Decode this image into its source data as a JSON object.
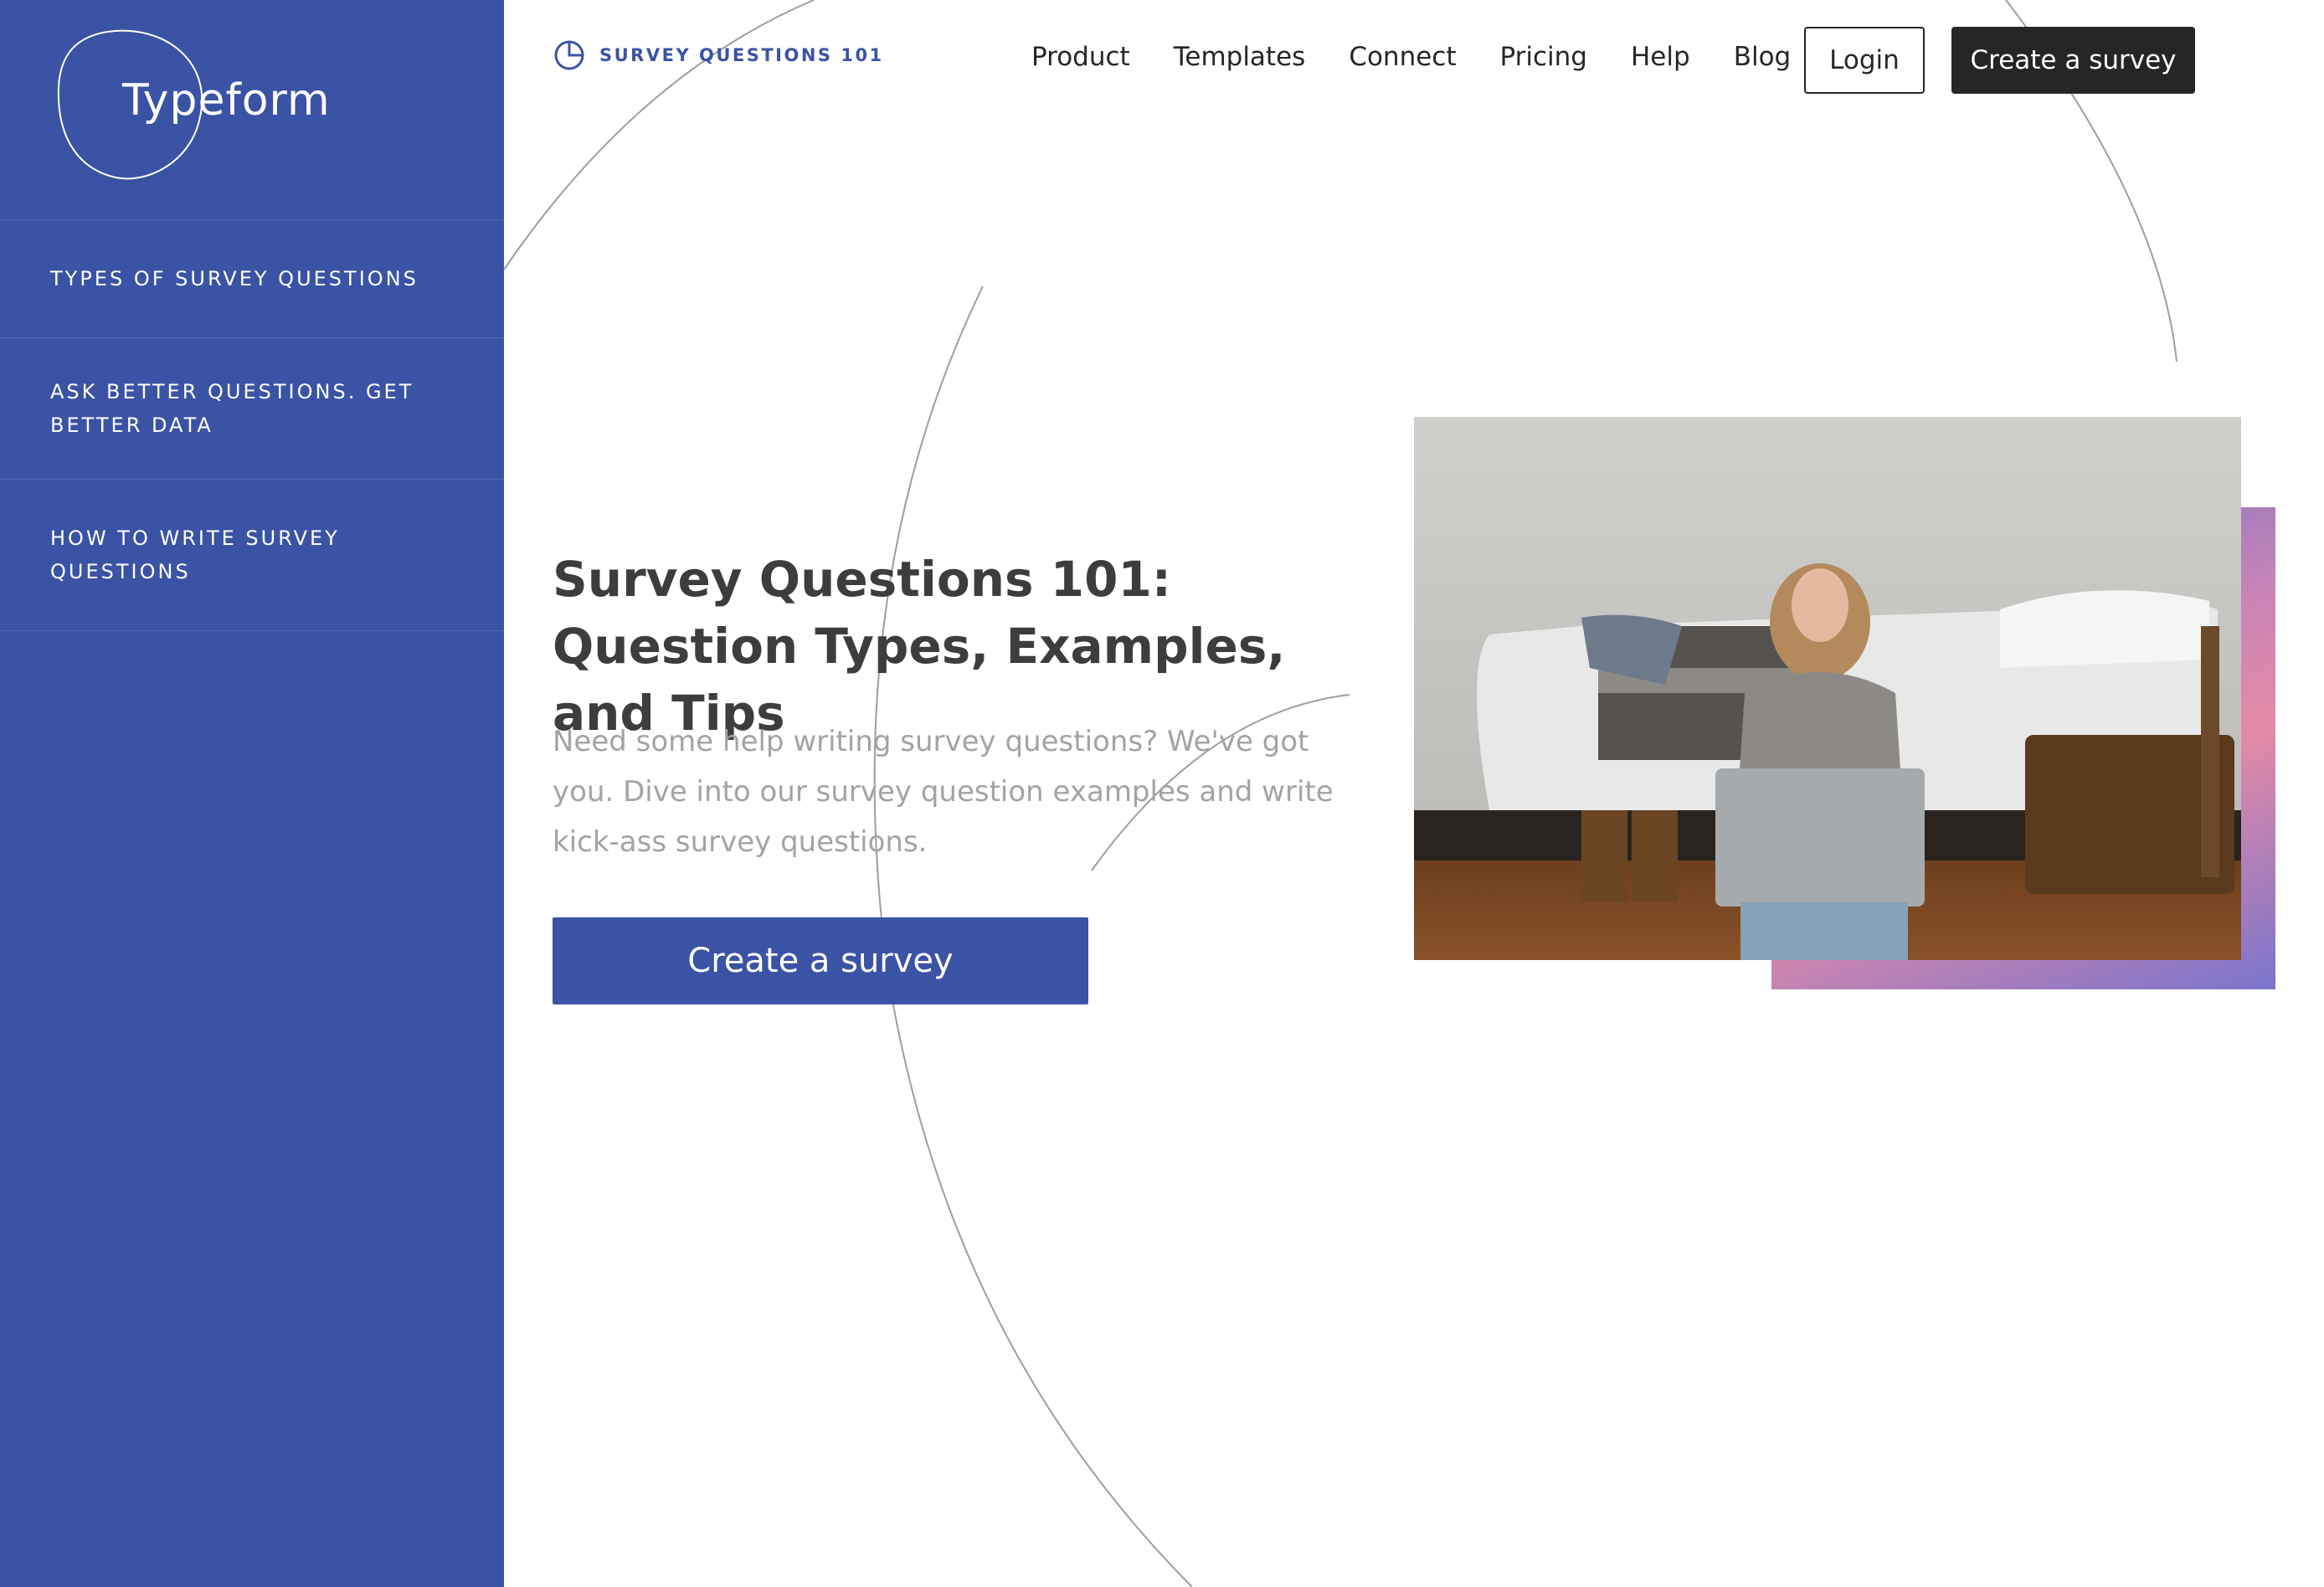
{
  "sidebar": {
    "logo_text": "Typeform",
    "items": [
      {
        "label": "TYPES OF SURVEY QUESTIONS"
      },
      {
        "label": "ASK BETTER QUESTIONS. GET BETTER DATA"
      },
      {
        "label": "HOW TO WRITE SURVEY QUESTIONS"
      }
    ]
  },
  "header": {
    "brand_label": "SURVEY QUESTIONS 101",
    "nav": [
      {
        "label": "Product"
      },
      {
        "label": "Templates"
      },
      {
        "label": "Connect"
      },
      {
        "label": "Pricing"
      },
      {
        "label": "Help"
      },
      {
        "label": "Blog"
      }
    ],
    "login_label": "Login",
    "create_label": "Create a survey"
  },
  "hero": {
    "title": "Survey Questions 101: Question Types, Examples, and Tips",
    "description": "Need some help writing survey questions? We've got you. Dive into our survey question examples and write kick-ass survey questions.",
    "cta_label": "Create a survey"
  },
  "colors": {
    "brand_blue": "#3a53a4",
    "dark": "#262627",
    "muted_text": "#a3a3a3"
  },
  "icons": {
    "brand_icon": "pie-chart-icon"
  }
}
